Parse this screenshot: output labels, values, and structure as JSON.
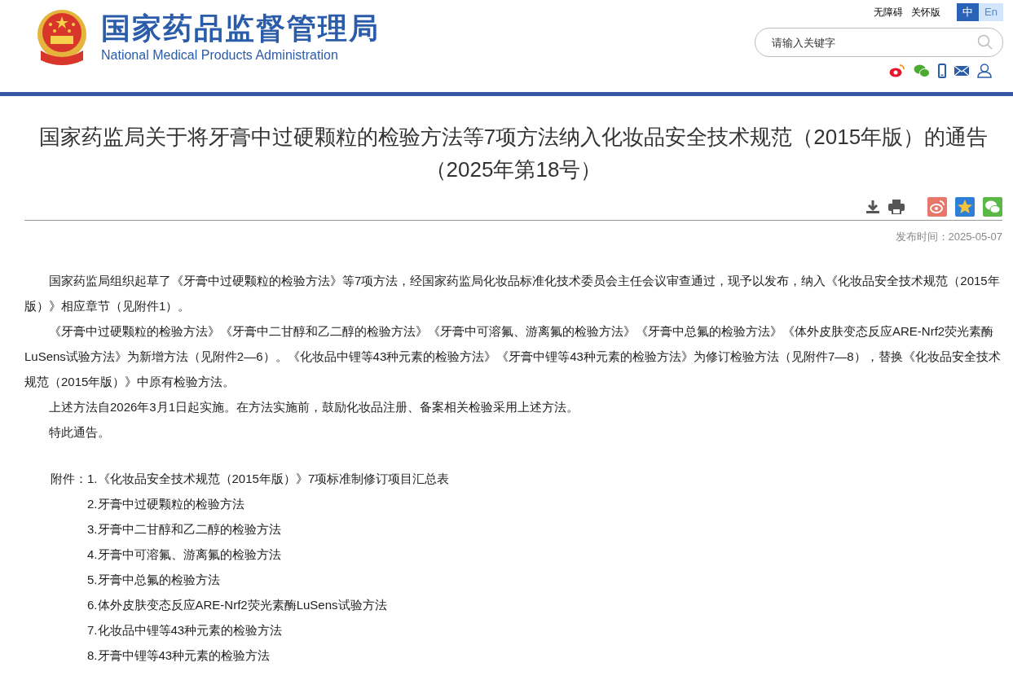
{
  "header": {
    "logo_cn": "国家药品监督管理局",
    "logo_en": "National Medical Products Administration",
    "top_links": [
      "无障碍",
      "关怀版"
    ],
    "languages": [
      {
        "label": "中",
        "selected": true
      },
      {
        "label": "En",
        "selected": false
      }
    ],
    "search": {
      "placeholder": "请输入关键字"
    }
  },
  "article": {
    "title": "国家药监局关于将牙膏中过硬颗粒的检验方法等7项方法纳入化妆品安全技术规范（2015年版）的通告（2025年第18号）",
    "date": "发布时间：2025-05-07",
    "paragraphs": [
      "国家药监局组织起草了《牙膏中过硬颗粒的检验方法》等7项方法，经国家药监局化妆品标准化技术委员会主任会议审查通过，现予以发布，纳入《化妆品安全技术规范（2015年版）》相应章节（见附件1）。",
      "《牙膏中过硬颗粒的检验方法》《牙膏中二甘醇和乙二醇的检验方法》《牙膏中可溶氟、游离氟的检验方法》《牙膏中总氟的检验方法》《体外皮肤变态反应ARE-Nrf2荧光素酶LuSens试验方法》为新增方法（见附件2—6）。《化妆品中锂等43种元素的检验方法》《牙膏中锂等43种元素的检验方法》为修订检验方法（见附件7—8），替换《化妆品安全技术规范（2015年版）》中原有检验方法。",
      "上述方法自2026年3月1日起实施。在方法实施前，鼓励化妆品注册、备案相关检验采用上述方法。",
      "特此通告。"
    ],
    "attachments_label": "附件：",
    "attachments": [
      "1.《化妆品安全技术规范（2015年版）》7项标准制修订项目汇总表",
      "2.牙膏中过硬颗粒的检验方法",
      "3.牙膏中二甘醇和乙二醇的检验方法",
      "4.牙膏中可溶氟、游离氟的检验方法",
      "5.牙膏中总氟的检验方法",
      "6.体外皮肤变态反应ARE-Nrf2荧光素酶LuSens试验方法",
      "7.化妆品中锂等43种元素的检验方法",
      "8.牙膏中锂等43种元素的检验方法"
    ]
  }
}
